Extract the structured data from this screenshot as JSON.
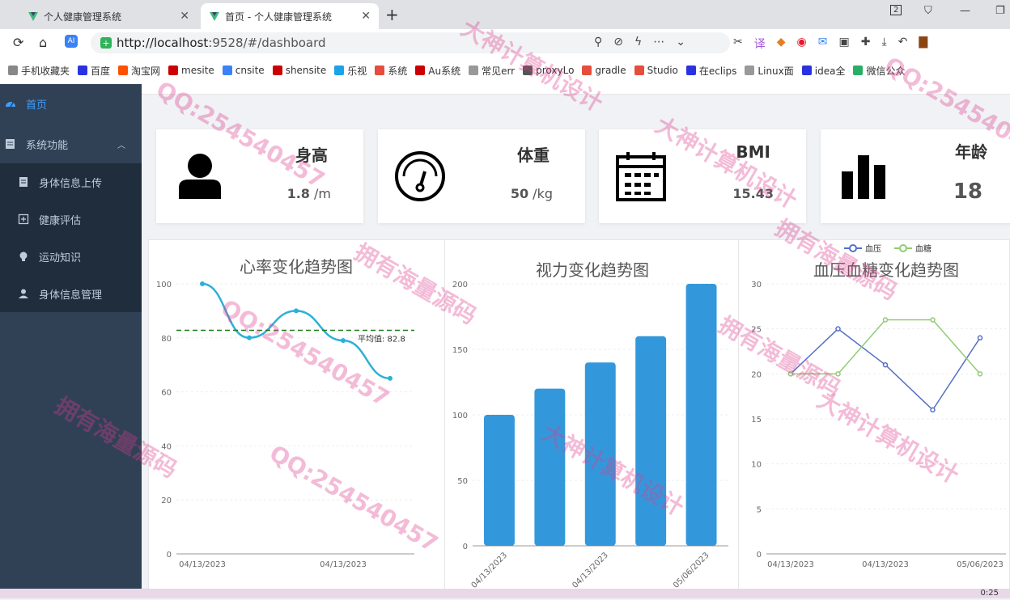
{
  "browser": {
    "tabs": [
      {
        "title": "个人健康管理系统",
        "active": false
      },
      {
        "title": "首页 - 个人健康管理系统",
        "active": true
      }
    ],
    "tab_count": "2",
    "url_host": "http://localhost",
    "url_path": ":9528/#/dashboard",
    "bookmarks": [
      "手机收藏夹",
      "百度",
      "淘宝网",
      "mesite",
      "cnsite",
      "shensite",
      "乐视",
      "系统",
      "Au系统",
      "常见err",
      "proxyLo",
      "gradle",
      "Studio",
      "在eclips",
      "Linux面",
      "idea全",
      "微信公众"
    ]
  },
  "sidebar": {
    "items": [
      {
        "label": "首页",
        "icon": "dashboard-icon",
        "active": true
      },
      {
        "label": "系统功能",
        "icon": "document-icon",
        "expanded": true
      },
      {
        "label": "身体信息上传",
        "icon": "upload-doc-icon"
      },
      {
        "label": "健康评估",
        "icon": "plus-box-icon"
      },
      {
        "label": "运动知识",
        "icon": "bulb-icon"
      },
      {
        "label": "身体信息管理",
        "icon": "user-icon"
      }
    ]
  },
  "cards": [
    {
      "title": "身高",
      "value": "1.8",
      "unit": " /m",
      "icon": "person-icon"
    },
    {
      "title": "体重",
      "value": "50",
      "unit": " /kg",
      "icon": "gauge-icon"
    },
    {
      "title": "BMI",
      "value": "15.43",
      "unit": "",
      "icon": "calendar-icon"
    },
    {
      "title": "年龄",
      "value": "18",
      "unit": "",
      "icon": "bar-chart-icon"
    }
  ],
  "chart_data": [
    {
      "type": "line",
      "title": "心率变化趋势图",
      "x": [
        "04/13/2023",
        "",
        "",
        "04/13/2023",
        ""
      ],
      "series": [
        {
          "values": [
            100,
            80,
            90,
            79,
            65
          ],
          "color": "#2ab1d9",
          "smooth": true
        }
      ],
      "markline": {
        "value": 82.8,
        "label": "平均值: 82.8",
        "color": "#1a7a1a"
      },
      "ylim": [
        0,
        100
      ],
      "yticks": [
        0,
        20,
        40,
        60,
        80,
        100
      ]
    },
    {
      "type": "bar",
      "title": "视力变化趋势图",
      "categories": [
        "04/13/2023",
        "",
        "04/13/2023",
        "",
        "05/06/2023"
      ],
      "values": [
        100,
        120,
        140,
        160,
        200
      ],
      "color": "#3398db",
      "ylim": [
        0,
        200
      ],
      "yticks": [
        0,
        50,
        100,
        150,
        200
      ]
    },
    {
      "type": "line",
      "title": "血压血糖变化趋势图",
      "x": [
        "04/13/2023",
        "",
        "04/13/2023",
        "",
        "05/06/2023"
      ],
      "series": [
        {
          "name": "血压",
          "values": [
            20,
            25,
            21,
            16,
            24
          ],
          "color": "#5470c6"
        },
        {
          "name": "血糖",
          "values": [
            20,
            20,
            26,
            26,
            20
          ],
          "color": "#91cc75"
        }
      ],
      "ylim": [
        0,
        30
      ],
      "yticks": [
        0,
        5,
        10,
        15,
        20,
        25,
        30
      ],
      "legend_position": "top-right"
    }
  ],
  "watermarks": [
    "大神计算机设计",
    "QQ:254540457",
    "拥有海量源码"
  ],
  "clock": "0:25",
  "colors": {
    "sidebar_bg": "#304156",
    "sidebar_active": "#409eff",
    "sidebar_sub_bg": "#1f2d3d"
  }
}
